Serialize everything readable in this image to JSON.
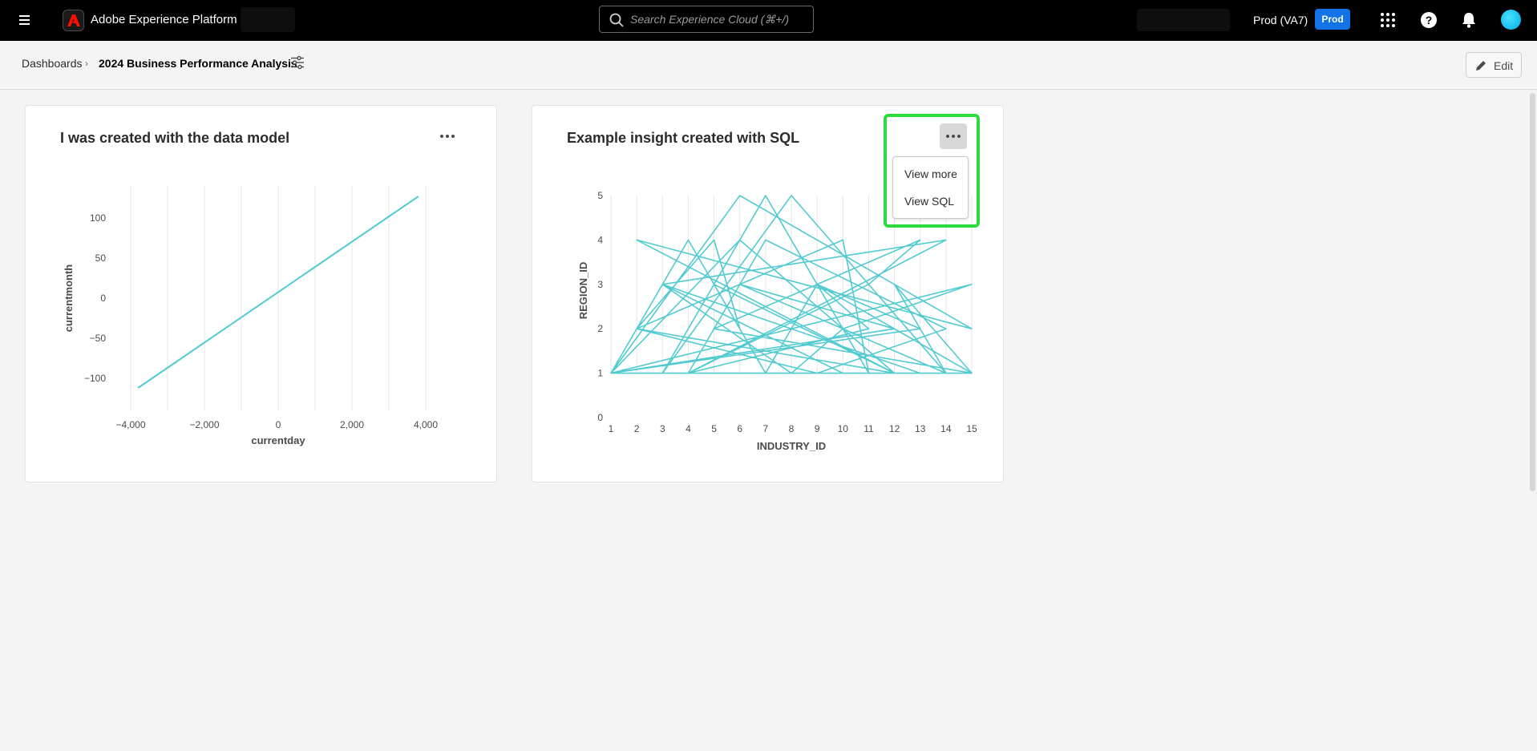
{
  "header": {
    "brand": "Adobe Experience Platform",
    "search_placeholder": "Search Experience Cloud (⌘+/)",
    "environment": "Prod (VA7)",
    "environment_badge": "Prod",
    "icons": [
      "menu-icon",
      "adobe-logo-icon",
      "search-icon",
      "apps-grid-icon",
      "help-icon",
      "bell-icon",
      "avatar"
    ]
  },
  "breadcrumb": {
    "root": "Dashboards",
    "current": "2024 Business Performance Analysis"
  },
  "toolbar": {
    "edit_label": "Edit"
  },
  "widgets": [
    {
      "title": "I was created with the data model"
    },
    {
      "title": "Example insight created with SQL",
      "menu": {
        "items": [
          "View more",
          "View SQL"
        ]
      }
    }
  ],
  "colors": {
    "series": "#52cbd0",
    "accent": "#1473e6",
    "highlight": "#2ddc3c"
  },
  "chart_data": [
    {
      "type": "line",
      "xlabel": "currentday",
      "ylabel": "currentmonth",
      "xticks": [
        -4000,
        -2000,
        0,
        2000,
        4000
      ],
      "xtick_labels": [
        "−4,000",
        "−2,000",
        "0",
        "2,000",
        "4,000"
      ],
      "yticks": [
        100,
        50,
        0,
        -50,
        -100
      ],
      "ytick_labels": [
        "100",
        "50",
        "0",
        "−50",
        "−100"
      ],
      "xlim": [
        -4500,
        4500
      ],
      "ylim": [
        -140,
        140
      ],
      "grid": "vertical",
      "series": [
        {
          "x": [
            -3800,
            3800
          ],
          "y": [
            -112,
            127
          ]
        }
      ]
    },
    {
      "type": "line",
      "xlabel": "INDUSTRY_ID",
      "ylabel": "REGION_ID",
      "categories": [
        "1",
        "2",
        "3",
        "4",
        "5",
        "6",
        "7",
        "8",
        "9",
        "10",
        "11",
        "12",
        "13",
        "14",
        "15"
      ],
      "yticks": [
        5,
        4,
        3,
        2,
        1,
        0
      ],
      "ylim": [
        0,
        5
      ],
      "grid": "vertical",
      "series": [
        {
          "x": [
            1,
            4,
            6,
            5,
            2,
            10,
            11,
            7,
            3,
            8,
            14,
            12,
            15,
            9,
            13,
            1,
            6,
            15,
            2,
            12,
            5,
            7,
            9,
            11,
            4,
            14,
            3,
            13,
            8,
            10,
            15,
            1,
            6,
            12,
            2,
            9,
            14,
            7,
            4,
            11,
            13,
            5,
            15,
            8,
            3,
            10,
            1,
            12,
            6,
            14
          ],
          "y": [
            1,
            4,
            2,
            4,
            2,
            4,
            1,
            5,
            1,
            5,
            1,
            3,
            1,
            3,
            2,
            1,
            5,
            2,
            4,
            1,
            3,
            1,
            3,
            2,
            1,
            4,
            3,
            1,
            1,
            2,
            3,
            1,
            4,
            1,
            2,
            1,
            2,
            4,
            1,
            3,
            4,
            2,
            1,
            1,
            3,
            1,
            1,
            2,
            3,
            1
          ]
        }
      ]
    }
  ]
}
